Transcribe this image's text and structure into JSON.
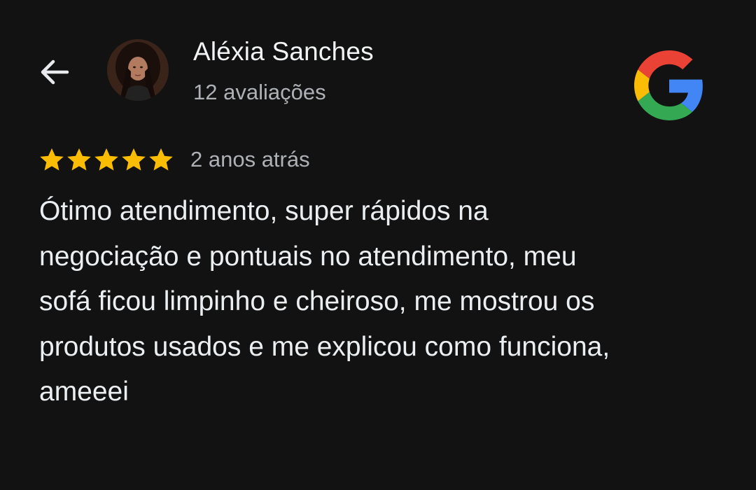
{
  "header": {
    "back_icon": "arrow-back-icon",
    "author": {
      "name": "Aléxia Sanches",
      "reviews_count": "12 avaliações",
      "avatar_icon": "profile-photo"
    },
    "brand_logo": "google-g-logo",
    "brand_colors": {
      "red": "#EA4335",
      "yellow": "#FBBC05",
      "green": "#34A853",
      "blue": "#4285F4"
    }
  },
  "review": {
    "rating": 5,
    "rating_max": 5,
    "star_color": "#FBBC04",
    "time_ago": "2 anos atrás",
    "text_lines": [
      "Ótimo atendimento, super rápidos na",
      "negociação e pontuais no atendimento, meu",
      "sofá ficou limpinho e cheiroso, me mostrou os",
      "produtos usados e me explicou como funciona,",
      "ameeei"
    ]
  },
  "theme": {
    "background": "#121212",
    "primary_text": "#E8EAED",
    "secondary_text": "#AEB1B5"
  }
}
